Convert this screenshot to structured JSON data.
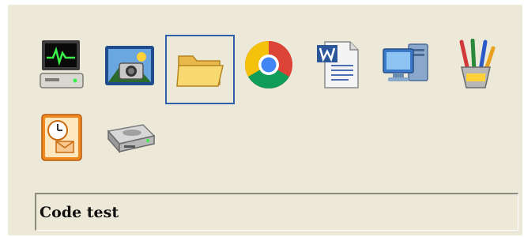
{
  "icons": [
    {
      "name": "computer-monitor-icon",
      "selected": false
    },
    {
      "name": "camera-picture-icon",
      "selected": false
    },
    {
      "name": "folder-icon",
      "selected": true
    },
    {
      "name": "chrome-icon",
      "selected": false
    },
    {
      "name": "word-document-icon",
      "selected": false
    },
    {
      "name": "network-computer-icon",
      "selected": false
    },
    {
      "name": "paint-brushes-icon",
      "selected": false
    },
    {
      "name": "scheduler-clock-icon",
      "selected": false
    },
    {
      "name": "hard-drive-icon",
      "selected": false
    }
  ],
  "status": {
    "text": "Code test"
  },
  "colors": {
    "panel_background": "#ece9d8",
    "selection_border": "#2f5faa"
  }
}
